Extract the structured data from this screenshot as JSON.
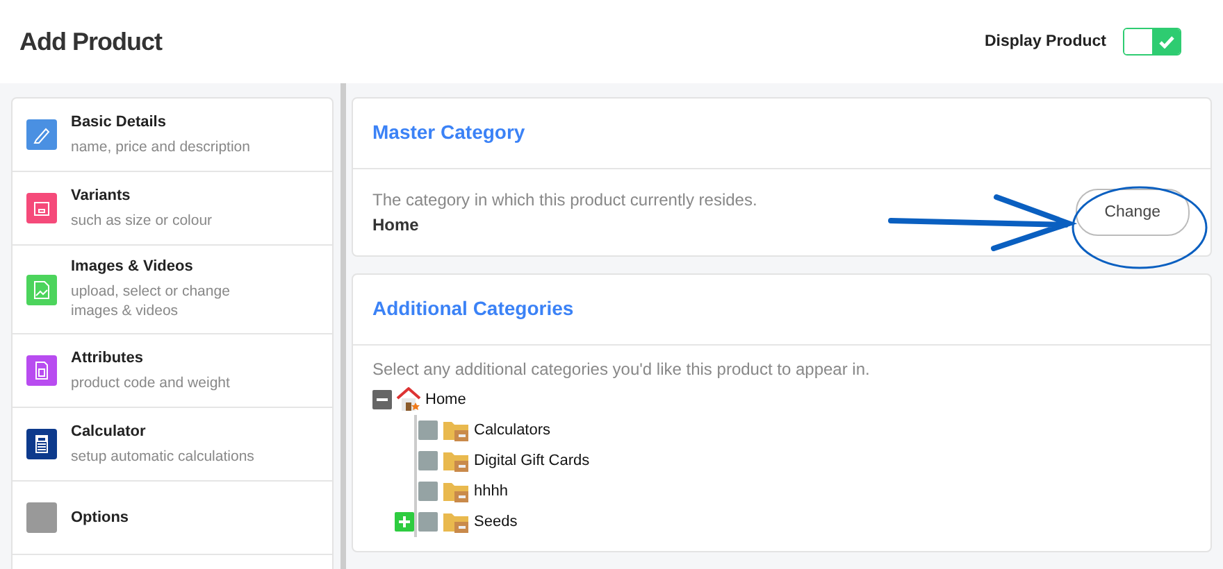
{
  "page_title": "Add Product",
  "display_toggle": {
    "label": "Display Product",
    "on": true
  },
  "sidebar": {
    "items": [
      {
        "title": "Basic Details",
        "subtitle": "name, price and description",
        "color": "#4a90e2"
      },
      {
        "title": "Variants",
        "subtitle": "such as size or colour",
        "color": "#f54a7a"
      },
      {
        "title": "Images & Videos",
        "subtitle": "upload, select or change images & videos",
        "color": "#4cd45c"
      },
      {
        "title": "Attributes",
        "subtitle": "product code and weight",
        "color": "#b84cf0"
      },
      {
        "title": "Calculator",
        "subtitle": "setup automatic calculations",
        "color": "#0d3a8c"
      },
      {
        "title": "Options",
        "color": "#999999"
      }
    ]
  },
  "master_category": {
    "title": "Master Category",
    "description": "The category in which this product currently resides.",
    "value": "Home",
    "button": "Change"
  },
  "additional_categories": {
    "title": "Additional Categories",
    "description": "Select any additional categories you'd like this product to appear in.",
    "tree": [
      {
        "label": "Home",
        "kind": "home",
        "expanded": true,
        "children": [
          {
            "label": "Calculators",
            "kind": "folder",
            "checked": false
          },
          {
            "label": "Digital Gift Cards",
            "kind": "folder",
            "checked": false
          },
          {
            "label": "hhhh",
            "kind": "folder",
            "checked": false
          },
          {
            "label": "Seeds",
            "kind": "folder",
            "checked": false,
            "expanded": false
          }
        ]
      }
    ]
  }
}
